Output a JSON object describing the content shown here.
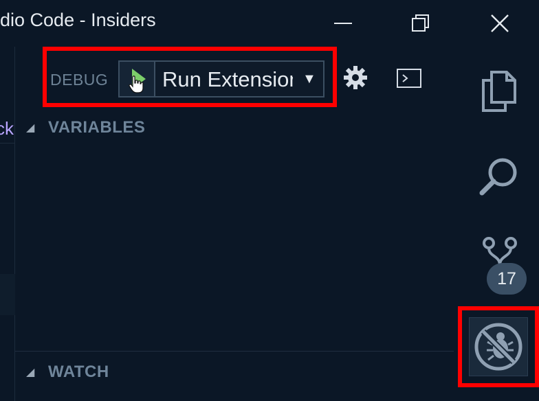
{
  "window": {
    "title": "dio Code - Insiders"
  },
  "debug_toolbar": {
    "label": "DEBUG",
    "configuration": "Run Extension",
    "start_icon": "play-icon",
    "settings_icon": "gear-icon",
    "console_icon": "terminal-icon"
  },
  "editor": {
    "tab_fragment": "ck"
  },
  "sections": {
    "variables": "VARIABLES",
    "watch": "WATCH"
  },
  "activity_bar": {
    "explorer_icon": "files-icon",
    "search_icon": "search-icon",
    "git_icon": "source-control-icon",
    "git_badge": "17",
    "debug_icon": "no-debug-icon"
  },
  "colors": {
    "background": "#0b1726",
    "highlight": "#ff0000",
    "play_green": "#7ccf6a",
    "icon_gray": "#8fa0b2"
  }
}
